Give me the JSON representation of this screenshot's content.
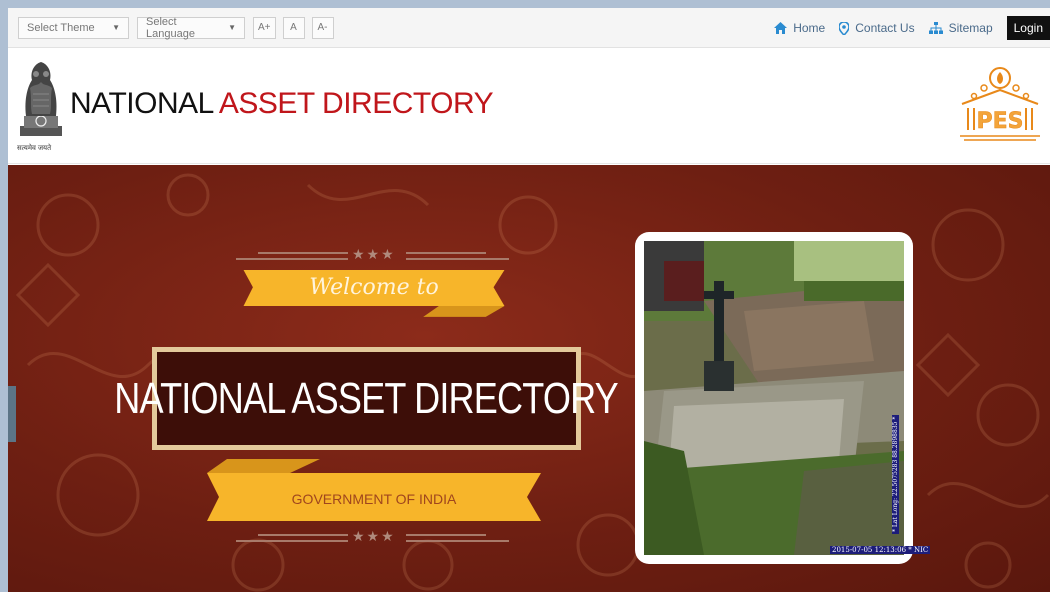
{
  "topbar": {
    "theme_select": "Select Theme",
    "language_select": "Select Language",
    "font_increase": "A+",
    "font_normal": "A",
    "font_decrease": "A-",
    "links": {
      "home": "Home",
      "contact": "Contact Us",
      "sitemap": "Sitemap"
    },
    "login": "Login",
    "link_color": "#2a8bd0"
  },
  "header": {
    "title_part1": "NATIONAL",
    "title_part2": "ASSET DIRECTORY",
    "emblem_caption": "सत्यमेव जयते",
    "title_accent_color": "#c0161b",
    "logo_text": "PES"
  },
  "banner": {
    "welcome": "Welcome to",
    "main_title": "NATIONAL ASSET DIRECTORY",
    "subtitle": "GOVERNMENT OF INDIA",
    "photo_timestamp": "2015-07-05 12:13:06 * NIC",
    "photo_latlong": "* Lat Long: 22.5075283 88.2898835 *",
    "background_color": "#6e1f12",
    "ribbon_color": "#f7b52a"
  }
}
